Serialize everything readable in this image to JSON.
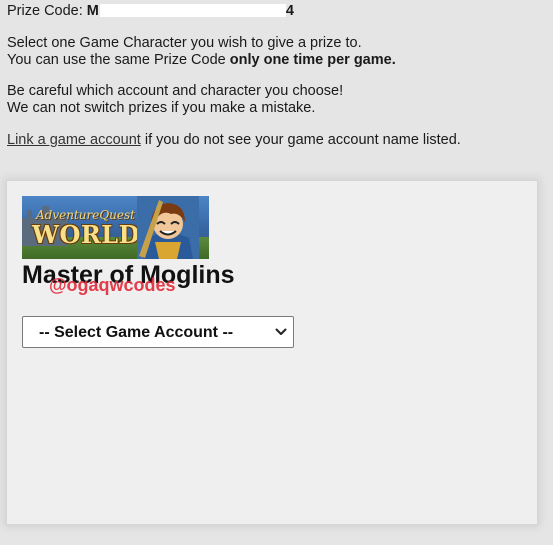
{
  "prize": {
    "label": "Prize Code:",
    "code_start": "M",
    "code_end": "4"
  },
  "instructions": {
    "line1": "Select one Game Character you wish to give a prize to.",
    "line2_prefix": "You can use the same Prize Code ",
    "line2_bold": "only one time per game.",
    "line3": "Be careful which account and character you choose!",
    "line4": "We can not switch prizes if you make a mistake.",
    "link_text": "Link a game account",
    "link_suffix": " if you do not see your game account name listed."
  },
  "game": {
    "logo_small": "AdventureQuest",
    "logo_word": "WORLDS",
    "title": "Master of Moglins",
    "watermark": "@ogaqwcodes",
    "select": {
      "selected": "-- Select Game Account --"
    }
  },
  "colors": {
    "background": "#e5e5e5",
    "panel": "#efefef",
    "watermark": "#e12a3a"
  }
}
